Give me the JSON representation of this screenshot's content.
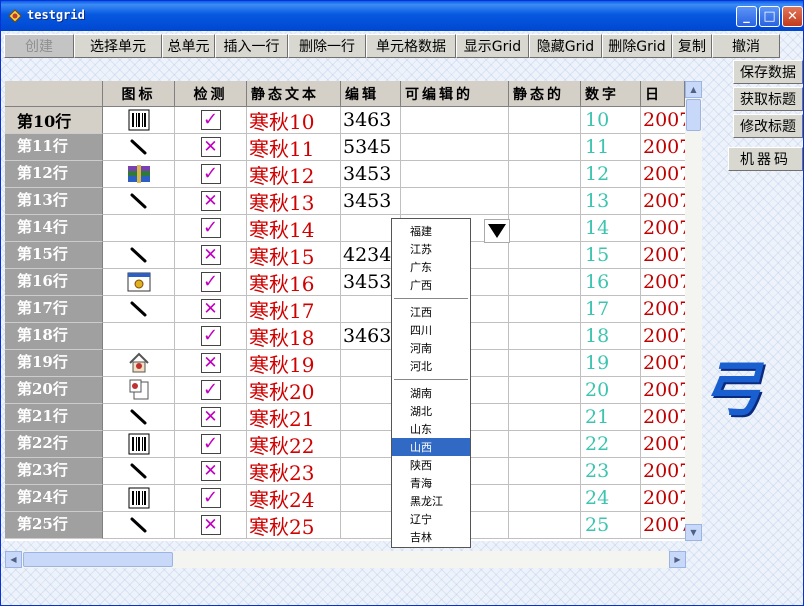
{
  "window": {
    "title": "testgrid"
  },
  "toolbar": {
    "buttons": [
      {
        "label": "创建",
        "w": 70,
        "disabled": true
      },
      {
        "label": "选择单元",
        "w": 88
      },
      {
        "label": "总单元",
        "w": 53
      },
      {
        "label": "插入一行",
        "w": 73
      },
      {
        "label": "删除一行",
        "w": 78
      },
      {
        "label": "单元格数据",
        "w": 90
      },
      {
        "label": "显示Grid",
        "w": 73
      },
      {
        "label": "隐藏Grid",
        "w": 73
      },
      {
        "label": "删除Grid",
        "w": 70
      },
      {
        "label": "复制",
        "w": 40
      },
      {
        "label": "撤消",
        "w": 68
      }
    ]
  },
  "side": {
    "buttons": [
      "保存数据",
      "获取标题",
      "修改标题"
    ],
    "machine_code": "机器码"
  },
  "grid": {
    "headers": [
      "图标",
      "检测",
      "静态文本",
      "编辑",
      "可编辑的",
      "静态的",
      "数字",
      "日"
    ],
    "rows": [
      {
        "label": "第10行",
        "icon": "barcode-icon",
        "check": true,
        "static": "寒秋10",
        "edit": "3463",
        "num": "10",
        "date": "2007",
        "sel": true
      },
      {
        "label": "第11行",
        "icon": "pen-icon",
        "check": false,
        "static": "寒秋11",
        "edit": "5345",
        "num": "11",
        "date": "2007"
      },
      {
        "label": "第12行",
        "icon": "archive-icon",
        "check": true,
        "static": "寒秋12",
        "edit": "3453",
        "num": "12",
        "date": "2007"
      },
      {
        "label": "第13行",
        "icon": "pen-icon",
        "check": false,
        "static": "寒秋13",
        "edit": "3453",
        "num": "13",
        "date": "2007"
      },
      {
        "label": "第14行",
        "icon": "",
        "check": true,
        "static": "寒秋14",
        "edit": "",
        "num": "14",
        "date": "2007"
      },
      {
        "label": "第15行",
        "icon": "pen-icon",
        "check": false,
        "static": "寒秋15",
        "edit": "4234",
        "num": "15",
        "date": "2007"
      },
      {
        "label": "第16行",
        "icon": "window-icon",
        "check": true,
        "static": "寒秋16",
        "edit": "3453",
        "num": "16",
        "date": "2007"
      },
      {
        "label": "第17行",
        "icon": "pen-icon",
        "check": false,
        "static": "寒秋17",
        "edit": "",
        "num": "17",
        "date": "2007"
      },
      {
        "label": "第18行",
        "icon": "",
        "check": true,
        "static": "寒秋18",
        "edit": "3463",
        "num": "18",
        "date": "2007"
      },
      {
        "label": "第19行",
        "icon": "home-icon",
        "check": false,
        "static": "寒秋19",
        "edit": "",
        "num": "19",
        "date": "2007"
      },
      {
        "label": "第20行",
        "icon": "document-icon",
        "check": true,
        "static": "寒秋20",
        "edit": "",
        "num": "20",
        "date": "2007"
      },
      {
        "label": "第21行",
        "icon": "pen-icon",
        "check": false,
        "static": "寒秋21",
        "edit": "",
        "num": "21",
        "date": "2007"
      },
      {
        "label": "第22行",
        "icon": "barcode-icon",
        "check": true,
        "static": "寒秋22",
        "edit": "",
        "num": "22",
        "date": "2007"
      },
      {
        "label": "第23行",
        "icon": "pen-icon",
        "check": false,
        "static": "寒秋23",
        "edit": "",
        "num": "23",
        "date": "2007"
      },
      {
        "label": "第24行",
        "icon": "barcode-icon",
        "check": true,
        "static": "寒秋24",
        "edit": "",
        "num": "24",
        "date": "2007"
      },
      {
        "label": "第25行",
        "icon": "pen-icon",
        "check": false,
        "static": "寒秋25",
        "edit": "",
        "num": "25",
        "date": "2007"
      }
    ]
  },
  "dropdown": {
    "groups": [
      [
        "福建",
        "江苏",
        "广东",
        "广西"
      ],
      [
        "江西",
        "四川",
        "河南",
        "河北"
      ],
      [
        "湖南",
        "湖北",
        "山东",
        "山西",
        "陕西",
        "青海",
        "黑龙江",
        "辽宁",
        "吉林"
      ]
    ],
    "selected": "山西"
  },
  "decoration": {
    "glyph": "弓"
  }
}
